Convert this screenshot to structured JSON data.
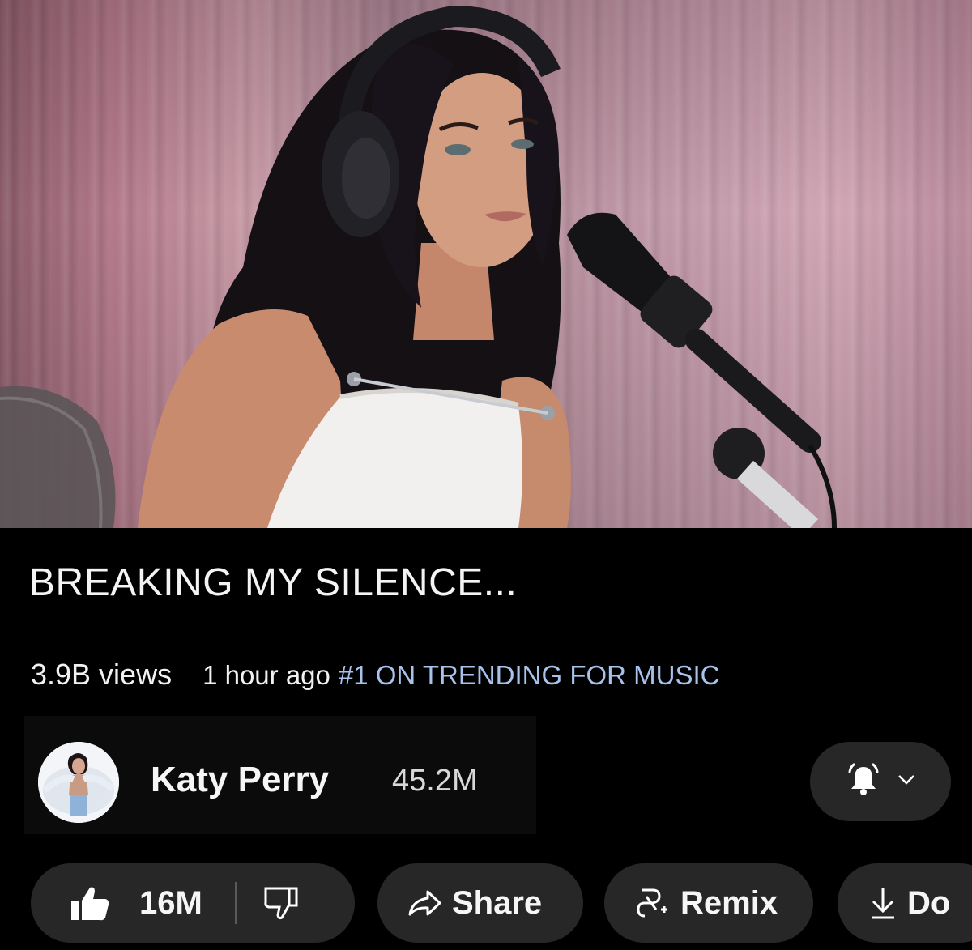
{
  "video": {
    "title": "BREAKING MY SILENCE...",
    "views": "3.9B views",
    "published": "1 hour ago",
    "trending": "#1 ON TRENDING FOR MUSIC"
  },
  "channel": {
    "name": "Katy Perry",
    "subscribers": "45.2M",
    "avatar_icon": "channel-avatar",
    "notification_icon": "bell-icon",
    "menu_icon": "chevron-down-icon"
  },
  "actions": {
    "like_count": "16M",
    "share_label": "Share",
    "remix_label": "Remix",
    "download_label": "Do"
  },
  "colors": {
    "background": "#000000",
    "pill": "#272727",
    "trending": "#a7c3ec",
    "text": "#f1f1f1"
  }
}
